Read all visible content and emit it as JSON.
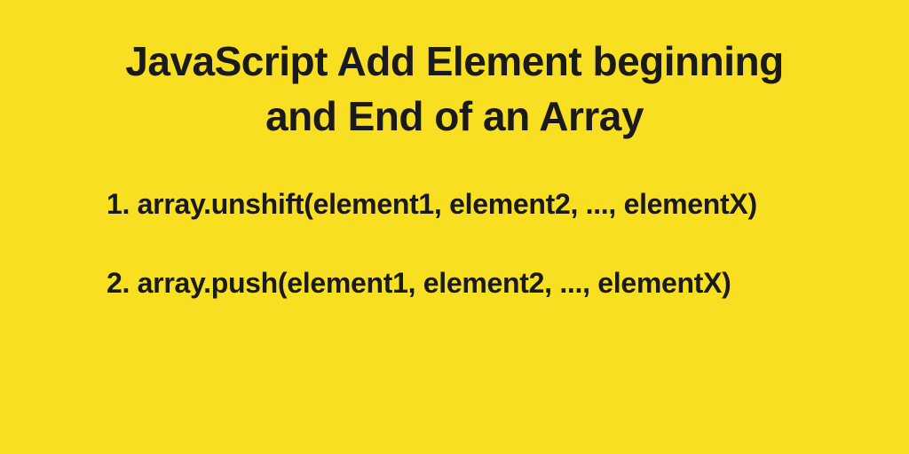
{
  "title_line1": "JavaScript Add Element beginning",
  "title_line2": "and End of an Array",
  "items": [
    "1. array.unshift(element1, element2, ..., elementX)",
    "2. array.push(element1, element2, ..., elementX)"
  ]
}
